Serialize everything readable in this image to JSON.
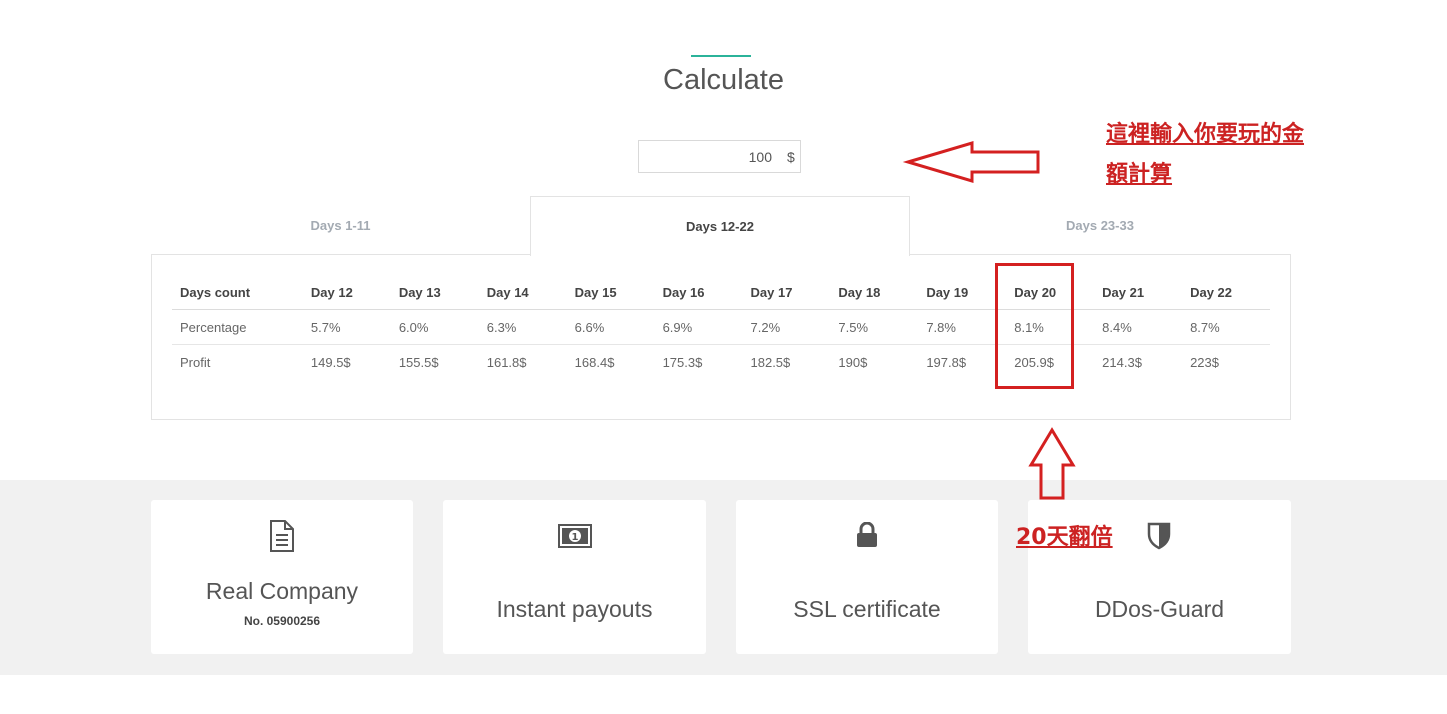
{
  "page": {
    "title": "Calculate"
  },
  "calculator": {
    "amount_value": "100",
    "currency_symbol": "$"
  },
  "tabs": [
    {
      "label": "Days 1-11",
      "active": false
    },
    {
      "label": "Days 12-22",
      "active": true
    },
    {
      "label": "Days 23-33",
      "active": false
    }
  ],
  "table": {
    "headers": [
      "Days count",
      "Day 12",
      "Day 13",
      "Day 14",
      "Day 15",
      "Day 16",
      "Day 17",
      "Day 18",
      "Day 19",
      "Day 20",
      "Day 21",
      "Day 22"
    ],
    "rows": [
      {
        "cells": [
          "Percentage",
          "5.7%",
          "6.0%",
          "6.3%",
          "6.6%",
          "6.9%",
          "7.2%",
          "7.5%",
          "7.8%",
          "8.1%",
          "8.4%",
          "8.7%"
        ]
      },
      {
        "cells": [
          "Profit",
          "149.5$",
          "155.5$",
          "161.8$",
          "168.4$",
          "175.3$",
          "182.5$",
          "190$",
          "197.8$",
          "205.9$",
          "214.3$",
          "223$"
        ]
      }
    ]
  },
  "features": [
    {
      "icon": "document-icon",
      "title": "Real Company",
      "subtitle": "No. 05900256"
    },
    {
      "icon": "banknote-icon",
      "title": "Instant payouts"
    },
    {
      "icon": "lock-icon",
      "title": "SSL certificate"
    },
    {
      "icon": "shield-icon",
      "title": "DDos-Guard"
    }
  ],
  "annotations": {
    "input_note_line1": "這裡輸入你要玩的金",
    "input_note_line2": "額計算",
    "double_note": "20天翻倍"
  },
  "colors": {
    "accent": "#2bb39a",
    "annotation_red": "#d42020",
    "band_bg": "#f1f1f1"
  }
}
